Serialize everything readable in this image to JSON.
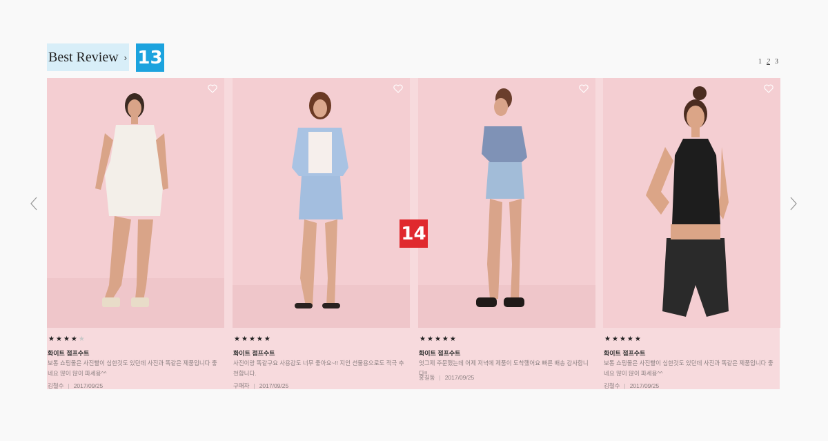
{
  "section": {
    "title": "Best Review",
    "title_arrow": "›",
    "badge_title": "13",
    "badge_carousel": "14"
  },
  "pagination": {
    "pages": [
      "1",
      "2",
      "3"
    ],
    "current": "2"
  },
  "colors": {
    "card_bg": "#f7dadd",
    "photo_bg": "#f4cfd2",
    "badge_blue": "#1ca3de",
    "badge_red": "#e0292e"
  },
  "reviews": [
    {
      "rating": 4,
      "max_rating": 5,
      "product": "화이트 점프수트",
      "text": "보통 쇼핑몰은 사진빨이 심한것도 있던데 사진과 똑같은 제품입니다 좋네요 많이 많이 파세용^^",
      "author": "김철수",
      "date": "2017/09/25"
    },
    {
      "rating": 5,
      "max_rating": 5,
      "product": "화이트 점프수트",
      "text": "사진이랑 똑같구요 사용감도 너무 좋아요~!! 지인 선물용으로도 적극 추천합니다.",
      "author": "구매자",
      "date": "2017/09/25"
    },
    {
      "rating": 5,
      "max_rating": 5,
      "product": "화이트 점프수트",
      "text": "엇그제 주문했는데 어제 저녁에 제품이 도착했어요 빠른 배송 감사합니다!!",
      "author": "홍길동",
      "date": "2017/09/25"
    },
    {
      "rating": 5,
      "max_rating": 5,
      "product": "화이트 점프수트",
      "text": "보통 쇼핑몰은 사진빨이 심한것도 있던데 사진과 똑같은 제품입니다 좋네요 많이 많이 파세용^^",
      "author": "김철수",
      "date": "2017/09/25"
    }
  ],
  "meta_separator": "|"
}
